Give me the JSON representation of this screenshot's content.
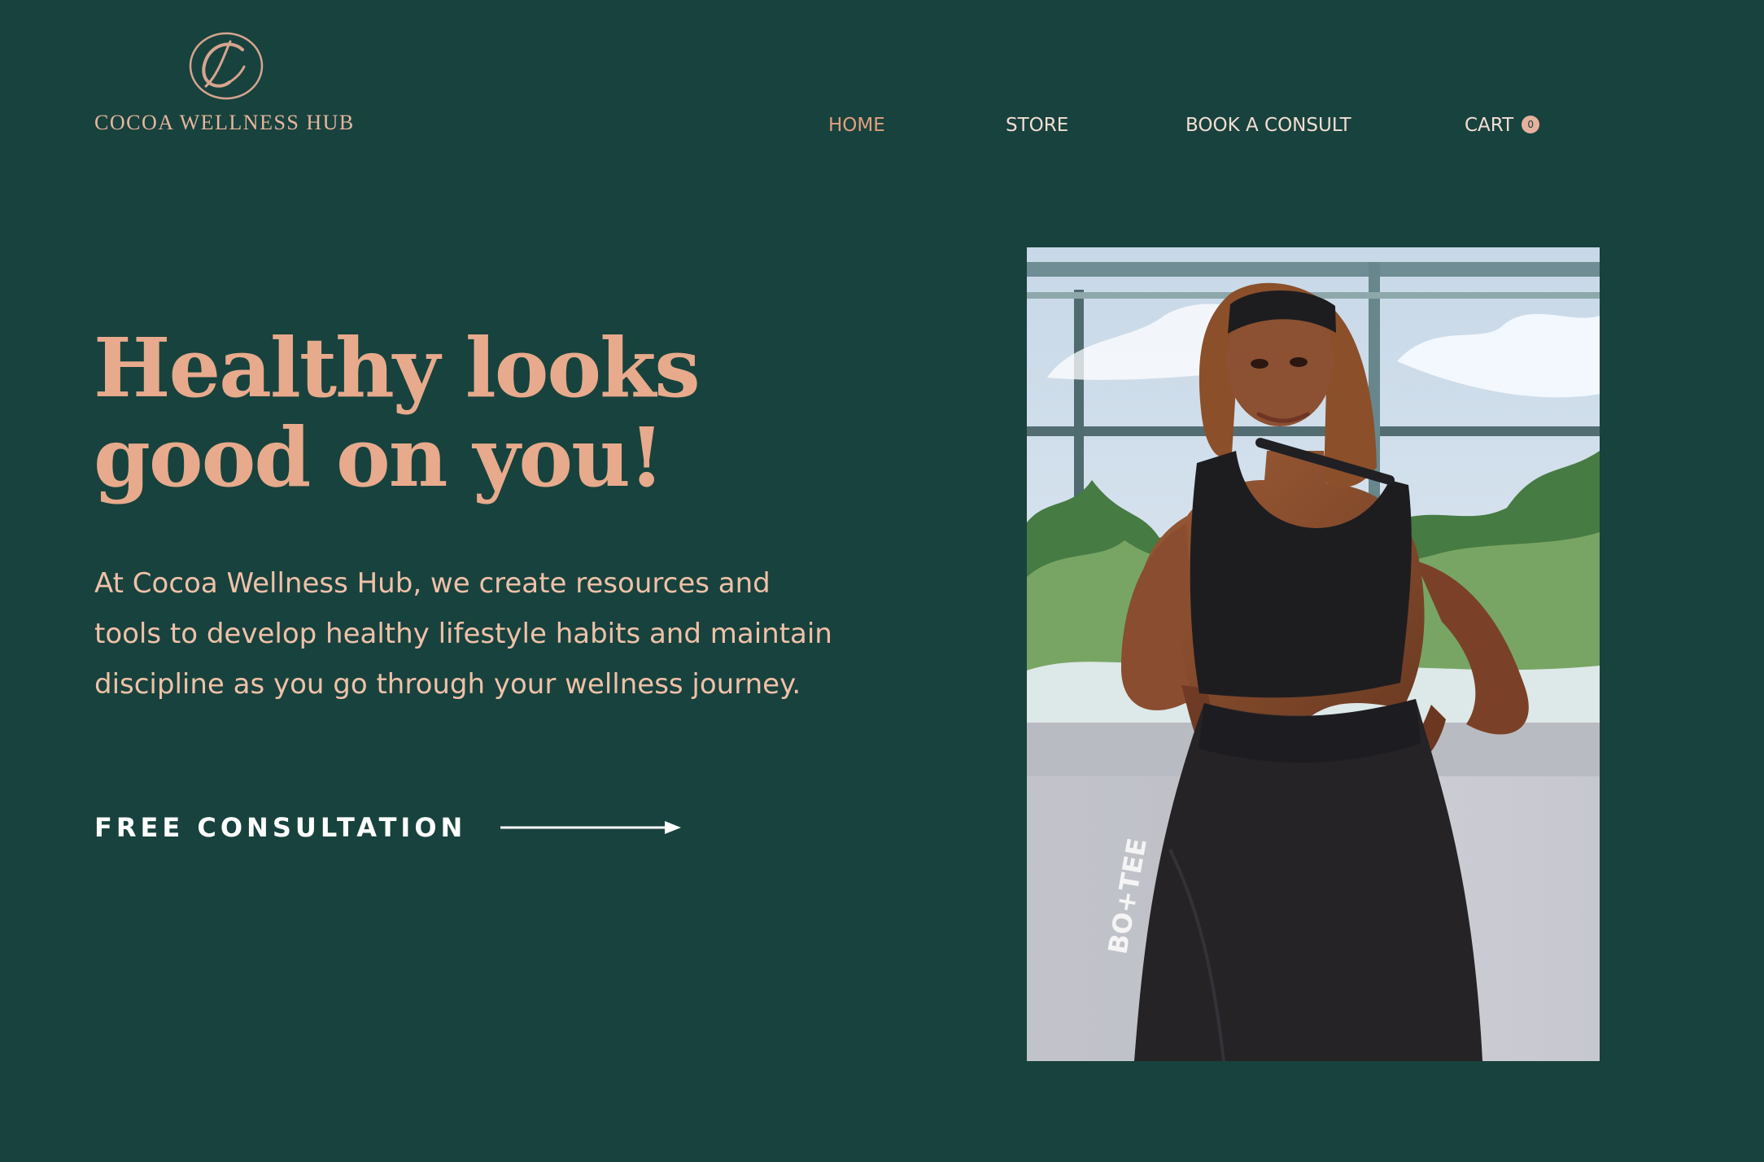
{
  "brand": {
    "name": "COCOA WELLNESS HUB",
    "monogram": "C"
  },
  "nav": {
    "items": [
      {
        "label": "HOME",
        "active": true
      },
      {
        "label": "STORE",
        "active": false
      },
      {
        "label": "BOOK A CONSULT",
        "active": false
      }
    ],
    "cart": {
      "label": "CART",
      "count": "0"
    }
  },
  "hero": {
    "headline": "Healthy looks\ngood on you!",
    "description": "At Cocoa Wellness Hub, we create resources and tools to develop healthy lifestyle habits and maintain discipline as you go through your wellness journey.",
    "cta_label": "FREE CONSULTATION",
    "image_text": "BO+TEE"
  },
  "colors": {
    "background": "#18423d",
    "accent": "#e8aa8c",
    "nav_text": "#f3ded3",
    "active_nav": "#e0a07e",
    "cta_text": "#ffffff"
  },
  "icons": {
    "logo": "c-monogram-icon",
    "cart_badge": "cart-count-badge",
    "arrow": "arrow-right-icon"
  }
}
